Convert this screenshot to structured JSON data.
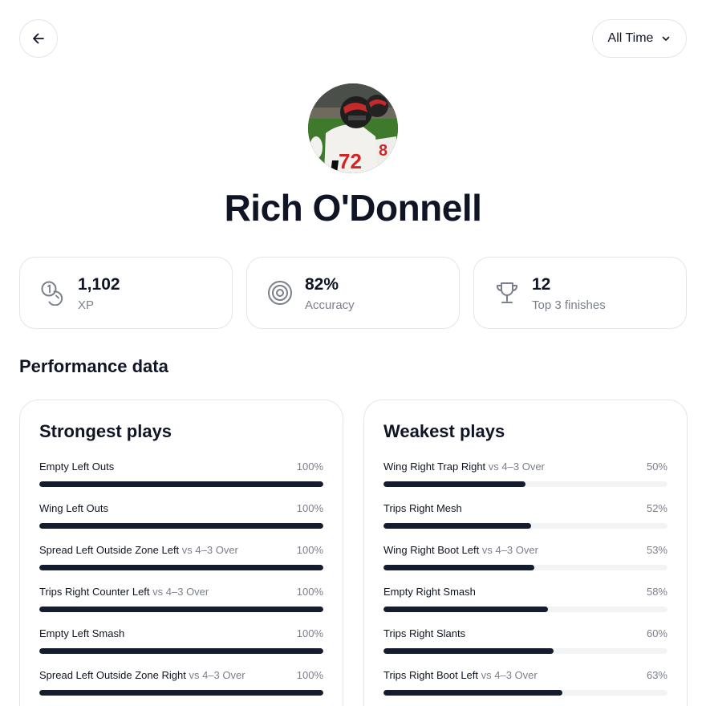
{
  "header": {
    "back_icon": "arrow-left-icon",
    "time_range": {
      "selected": "All Time",
      "icon": "chevron-down-icon"
    }
  },
  "profile": {
    "name": "Rich O'Donnell",
    "avatar": "football-player-photo"
  },
  "stats": [
    {
      "icon": "coins-icon",
      "value": "1,102",
      "label": "XP"
    },
    {
      "icon": "target-icon",
      "value": "82%",
      "label": "Accuracy"
    },
    {
      "icon": "trophy-icon",
      "value": "12",
      "label": "Top 3 finishes"
    }
  ],
  "performance": {
    "title": "Performance data",
    "strongest": {
      "title": "Strongest plays",
      "plays": [
        {
          "name": "Empty Left Outs",
          "vs": "",
          "pct_label": "100%",
          "value": 100
        },
        {
          "name": "Wing Left Outs",
          "vs": "",
          "pct_label": "100%",
          "value": 100
        },
        {
          "name": "Spread Left Outside Zone Left",
          "vs": "vs 4–3 Over",
          "pct_label": "100%",
          "value": 100
        },
        {
          "name": "Trips Right Counter Left",
          "vs": "vs 4–3 Over",
          "pct_label": "100%",
          "value": 100
        },
        {
          "name": "Empty Left Smash",
          "vs": "",
          "pct_label": "100%",
          "value": 100
        },
        {
          "name": "Spread Left Outside Zone Right",
          "vs": "vs 4–3 Over",
          "pct_label": "100%",
          "value": 100
        }
      ]
    },
    "weakest": {
      "title": "Weakest plays",
      "plays": [
        {
          "name": "Wing Right Trap Right",
          "vs": "vs 4–3 Over",
          "pct_label": "50%",
          "value": 50
        },
        {
          "name": "Trips Right Mesh",
          "vs": "",
          "pct_label": "52%",
          "value": 52
        },
        {
          "name": "Wing Right Boot Left",
          "vs": "vs 4–3 Over",
          "pct_label": "53%",
          "value": 53
        },
        {
          "name": "Empty Right Smash",
          "vs": "",
          "pct_label": "58%",
          "value": 58
        },
        {
          "name": "Trips Right Slants",
          "vs": "",
          "pct_label": "60%",
          "value": 60
        },
        {
          "name": "Trips Right Boot Left",
          "vs": "vs 4–3 Over",
          "pct_label": "63%",
          "value": 63
        }
      ]
    }
  },
  "colors": {
    "accent": "#141c2e",
    "track": "#f2f3f5",
    "muted": "#7a7f8c",
    "border": "#e3e5ea"
  }
}
